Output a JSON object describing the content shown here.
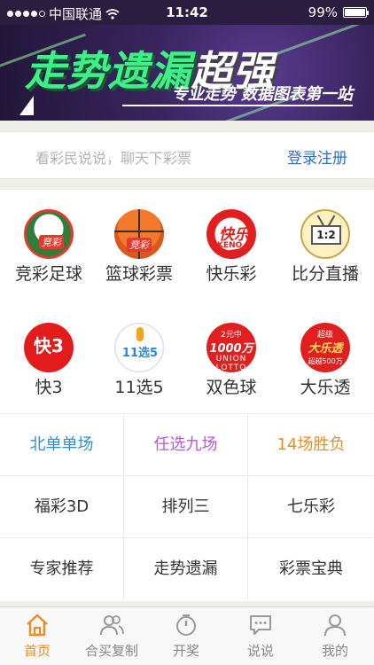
{
  "status_bar": {
    "carrier": "中国联通",
    "time": "11:42",
    "battery": "99%",
    "battery_level": 0.99
  },
  "banner": {
    "title_green": "走势遗漏",
    "title_white": "超强",
    "subtitle": "专业走势 数据图表第一站"
  },
  "chat": {
    "placeholder": "看彩民说说，聊天下彩票",
    "login": "登录注册"
  },
  "lottery_items": [
    {
      "label": "竞彩足球",
      "icon": "football-icon",
      "tag": "竞彩"
    },
    {
      "label": "篮球彩票",
      "icon": "basketball-icon",
      "tag": "竞彩"
    },
    {
      "label": "快乐彩",
      "icon": "kuaile-icon",
      "icon_text": "快乐彩",
      "icon_sub": "KENO"
    },
    {
      "label": "比分直播",
      "icon": "tv-icon",
      "icon_text": "1:2"
    },
    {
      "label": "快3",
      "icon": "kuai3-icon",
      "icon_text": "快3"
    },
    {
      "label": "11选5",
      "icon": "11x5-icon",
      "icon_text": "11选5"
    },
    {
      "label": "双色球",
      "icon": "shuangseqiu-icon",
      "icon_top": "2元中",
      "icon_mid": "1000万",
      "icon_bot": "UNION LOTTO"
    },
    {
      "label": "大乐透",
      "icon": "daletou-icon",
      "icon_top": "超级",
      "icon_mid": "大乐透",
      "icon_bot": "超越500万"
    }
  ],
  "links": [
    {
      "label": "北单单场",
      "color": "#2d8fd6"
    },
    {
      "label": "任选九场",
      "color": "#b45ad6"
    },
    {
      "label": "14场胜负",
      "color": "#f28a1d"
    },
    {
      "label": "福彩3D",
      "color": "#333333"
    },
    {
      "label": "排列三",
      "color": "#333333"
    },
    {
      "label": "七乐彩",
      "color": "#333333"
    },
    {
      "label": "专家推荐",
      "color": "#333333"
    },
    {
      "label": "走势遗漏",
      "color": "#333333"
    },
    {
      "label": "彩票宝典",
      "color": "#333333"
    }
  ],
  "tabs": [
    {
      "label": "首页",
      "icon": "home-icon",
      "active": true
    },
    {
      "label": "合买复制",
      "icon": "users-icon",
      "active": false
    },
    {
      "label": "开奖",
      "icon": "timer-icon",
      "active": false
    },
    {
      "label": "说说",
      "icon": "chat-icon",
      "active": false
    },
    {
      "label": "我的",
      "icon": "person-icon",
      "active": false
    }
  ],
  "colors": {
    "accent": "#f28a1d",
    "link_blue": "#2d6fc1",
    "tab_inactive": "#888888"
  }
}
